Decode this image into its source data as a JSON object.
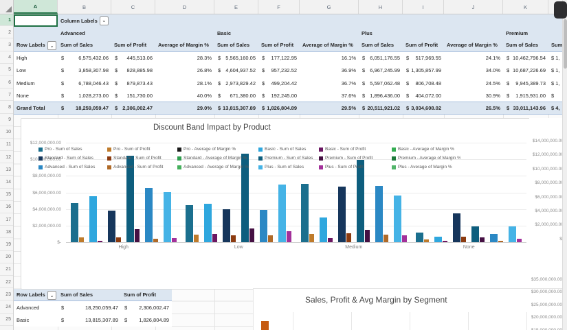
{
  "icons": {
    "dropdown_chevron": "⌄",
    "select_all_triangle": "corner-triangle"
  },
  "sheet": {
    "column_headers": [
      "A",
      "B",
      "C",
      "D",
      "E",
      "F",
      "G",
      "H",
      "I",
      "J",
      "K"
    ],
    "row_count": 25,
    "selected_column": "A",
    "selected_row": 1,
    "selected_cell": "A1"
  },
  "pivot_top": {
    "filter_label": "Column Labels",
    "row_header": "Row Labels",
    "col_groups": [
      "Advanced",
      "Basic",
      "Plus",
      "Premium"
    ],
    "measures": [
      "Sum of Sales",
      "Sum of Profit",
      "Average of Margin %"
    ],
    "clipped_header": "Sum",
    "rows": [
      {
        "label": "High",
        "cells": [
          "6,575,432.06",
          "445,513.06",
          "28.3%",
          "5,565,160.05",
          "177,122.95",
          "16.1%",
          "6,051,176.55",
          "517,969.55",
          "24.1%",
          "10,462,796.54",
          "1,"
        ]
      },
      {
        "label": "Low",
        "cells": [
          "3,858,307.98",
          "828,885.98",
          "26.8%",
          "4,604,937.52",
          "957,232.52",
          "36.9%",
          "6,967,245.99",
          "1,305,857.99",
          "34.0%",
          "10,687,226.69",
          "1,"
        ]
      },
      {
        "label": "Medium",
        "cells": [
          "6,788,046.43",
          "879,873.43",
          "28.1%",
          "2,973,829.42",
          "499,204.42",
          "36.7%",
          "5,597,062.48",
          "806,708.48",
          "24.5%",
          "9,945,389.73",
          "1,"
        ]
      },
      {
        "label": "None",
        "cells": [
          "1,028,273.00",
          "151,730.00",
          "40.0%",
          "671,380.00",
          "192,245.00",
          "37.6%",
          "1,896,436.00",
          "404,072.00",
          "30.9%",
          "1,915,931.00",
          ""
        ]
      },
      {
        "label": "Grand Total",
        "cells": [
          "18,259,059.47",
          "2,306,002.47",
          "29.0%",
          "13,815,307.89",
          "1,826,804.89",
          "29.5%",
          "20,511,921.02",
          "3,034,608.02",
          "26.5%",
          "33,011,143.96",
          "4,"
        ]
      }
    ]
  },
  "pivot_bottom": {
    "row_header": "Row Labels",
    "columns": [
      "Sum of Sales",
      "Sum of Profit"
    ],
    "rows": [
      {
        "label": "Advanced",
        "cells": [
          "18,250,059.47",
          "2,306,002.47"
        ]
      },
      {
        "label": "Basic",
        "cells": [
          "13,815,307.89",
          "1,826,804.89"
        ]
      }
    ]
  },
  "chart_data": [
    {
      "type": "bar",
      "title": "Discount Band Impact by Product",
      "categories": [
        "High",
        "Low",
        "Medium",
        "None"
      ],
      "primary_axis": {
        "ticks": [
          "$12,000,000.00",
          "$10,000,000.00",
          "$8,000,000.00",
          "$6,000,000.00",
          "$4,000,000.00",
          "$2,000,000.00",
          "$-"
        ],
        "max": 12000000
      },
      "secondary_axis": {
        "ticks": [
          "$14,000,000.00",
          "$12,000,000.00",
          "$10,000,000.00",
          "$8,000,000.00",
          "$6,000,000.00",
          "$4,000,000.00",
          "$2,000,000.00",
          "$-"
        ],
        "max": 14000000
      },
      "series": [
        {
          "name": "Pro",
          "sales_color": "#1b6f8e",
          "profit_color": "#bf7b2b",
          "margin_color": "#1a1a1a",
          "sales": [
            4700000,
            4500000,
            7000000,
            1200000
          ],
          "profit": [
            550000,
            900000,
            1000000,
            350000
          ],
          "margin_pct": null
        },
        {
          "name": "Basic",
          "sales_color": "#2fa7de",
          "profit_color": "#6b1762",
          "margin_color": "#35ad52",
          "sales": [
            5565160.05,
            4604937.52,
            2973829.42,
            671380.0
          ],
          "profit": [
            177122.95,
            957232.52,
            499204.42,
            192245.0
          ],
          "margin_pct": [
            16.1,
            36.9,
            36.7,
            37.6
          ]
        },
        {
          "name": "Standard",
          "sales_color": "#16365c",
          "profit_color": "#8c3b10",
          "margin_color": "#2f9e4f",
          "sales": [
            3800000,
            4000000,
            6700000,
            3500000
          ],
          "profit": [
            600000,
            850000,
            1050000,
            700000
          ],
          "margin_pct": null
        },
        {
          "name": "Premium",
          "sales_color": "#0e5e7e",
          "profit_color": "#451043",
          "margin_color": "#1d7a3a",
          "sales": [
            10462796.54,
            10687226.69,
            9945389.73,
            1915931.0
          ],
          "profit": [
            1550000,
            1700000,
            1500000,
            550000
          ],
          "margin_pct": null
        },
        {
          "name": "Advanced",
          "sales_color": "#2b88c4",
          "profit_color": "#b06a28",
          "margin_color": "#45b05c",
          "sales": [
            6575432.06,
            3858307.98,
            6788046.43,
            1028273.0
          ],
          "profit": [
            445513.06,
            828885.98,
            879873.43,
            151730.0
          ],
          "margin_pct": [
            28.3,
            26.8,
            28.1,
            40.0
          ]
        },
        {
          "name": "Plus",
          "sales_color": "#45b3e6",
          "profit_color": "#a3309a",
          "margin_color": "#52b56a",
          "sales": [
            6051176.55,
            6967245.99,
            5597062.48,
            1896436.0
          ],
          "profit": [
            517969.55,
            1305857.99,
            806708.48,
            404072.0
          ],
          "margin_pct": [
            24.1,
            34.0,
            24.5,
            30.9
          ]
        }
      ],
      "legend": [
        {
          "label": "Pro - Sum of Sales",
          "color": "#1b6f8e"
        },
        {
          "label": "Standard - Sum of Sales",
          "color": "#16365c"
        },
        {
          "label": "Advanced - Sum of Sales",
          "color": "#2b88c4"
        },
        {
          "label": "Pro - Sum of Profit",
          "color": "#bf7b2b"
        },
        {
          "label": "Standard - Sum of Profit",
          "color": "#8c3b10"
        },
        {
          "label": "Advanced - Sum of Profit",
          "color": "#b06a28"
        },
        {
          "label": "Pro - Average of Margin %",
          "color": "#1a1a1a"
        },
        {
          "label": "Standard - Average of Margin %",
          "color": "#2f9e4f"
        },
        {
          "label": "Advanced - Average of Margin %",
          "color": "#45b05c"
        },
        {
          "label": "Basic - Sum of Sales",
          "color": "#2fa7de"
        },
        {
          "label": "Premium - Sum of Sales",
          "color": "#0e5e7e"
        },
        {
          "label": "Plus - Sum of Sales",
          "color": "#45b3e6"
        },
        {
          "label": "Basic - Sum of Profit",
          "color": "#6b1762"
        },
        {
          "label": "Premium - Sum of Profit",
          "color": "#451043"
        },
        {
          "label": "Plus - Sum of Profit",
          "color": "#a3309a"
        },
        {
          "label": "Basic - Average of Margin %",
          "color": "#35ad52"
        },
        {
          "label": "Premium - Average of Margin %",
          "color": "#1d7a3a"
        },
        {
          "label": "Plus - Average of Margin %",
          "color": "#52b56a"
        }
      ]
    },
    {
      "type": "bar",
      "title": "Sales, Profit & Avg Margin by Segment",
      "axis_ticks_visible": [
        "$35,000,000.00",
        "$30,000,000.00",
        "$25,000,000.00",
        "$20,000,000.00",
        "$15,000,000.00"
      ],
      "visible_bar_color": "#c55a11"
    }
  ]
}
